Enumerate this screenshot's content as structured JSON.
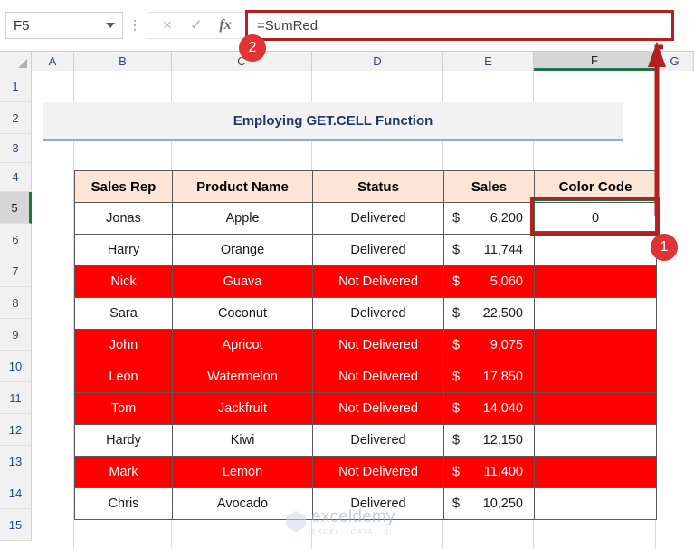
{
  "formula_bar": {
    "name_box_value": "F5",
    "name_box_caret": "chevron-down-icon",
    "cancel_icon": "×",
    "confirm_icon": "✓",
    "function_icon": "fx",
    "formula_value": "=SumRed"
  },
  "grid": {
    "columns": [
      "A",
      "B",
      "C",
      "D",
      "E",
      "F",
      "G"
    ],
    "active_column": "F",
    "rows": [
      "1",
      "2",
      "3",
      "4",
      "5",
      "6",
      "7",
      "8",
      "9",
      "10",
      "11",
      "12",
      "13",
      "14",
      "15"
    ],
    "active_row": "5"
  },
  "banner": {
    "title": "Employing GET.CELL Function"
  },
  "table": {
    "headers": [
      "Sales Rep",
      "Product Name",
      "Status",
      "Sales",
      "Color Code"
    ],
    "currency_symbol": "$",
    "rows": [
      {
        "rep": "Jonas",
        "product": "Apple",
        "status": "Delivered",
        "sales": "6,200",
        "code": "0",
        "red": false
      },
      {
        "rep": "Harry",
        "product": "Orange",
        "status": "Delivered",
        "sales": "11,744",
        "code": "",
        "red": false
      },
      {
        "rep": "Nick",
        "product": "Guava",
        "status": "Not Delivered",
        "sales": "5,060",
        "code": "",
        "red": true
      },
      {
        "rep": "Sara",
        "product": "Coconut",
        "status": "Delivered",
        "sales": "22,500",
        "code": "",
        "red": false
      },
      {
        "rep": "John",
        "product": "Apricot",
        "status": "Not Delivered",
        "sales": "9,075",
        "code": "",
        "red": true
      },
      {
        "rep": "Leon",
        "product": "Watermelon",
        "status": "Not Delivered",
        "sales": "17,850",
        "code": "",
        "red": true
      },
      {
        "rep": "Tom",
        "product": "Jackfruit",
        "status": "Not Delivered",
        "sales": "14,040",
        "code": "",
        "red": true
      },
      {
        "rep": "Hardy",
        "product": "Kiwi",
        "status": "Delivered",
        "sales": "12,150",
        "code": "",
        "red": false
      },
      {
        "rep": "Mark",
        "product": "Lemon",
        "status": "Not Delivered",
        "sales": "11,400",
        "code": "",
        "red": true
      },
      {
        "rep": "Chris",
        "product": "Avocado",
        "status": "Delivered",
        "sales": "10,250",
        "code": "",
        "red": false
      }
    ]
  },
  "annotations": {
    "badge_1": "1",
    "badge_2": "2"
  },
  "watermark": {
    "name": "exceldemy",
    "tagline": "EXCEL · DATA · BI"
  },
  "colors": {
    "highlight_red": "#FF0000",
    "header_fill": "#FCE4D6",
    "annotation_red": "#B32020",
    "badge_red": "#E03434",
    "excel_green": "#217346",
    "title_text": "#1F3864",
    "banner_underline": "#8FAADC"
  }
}
